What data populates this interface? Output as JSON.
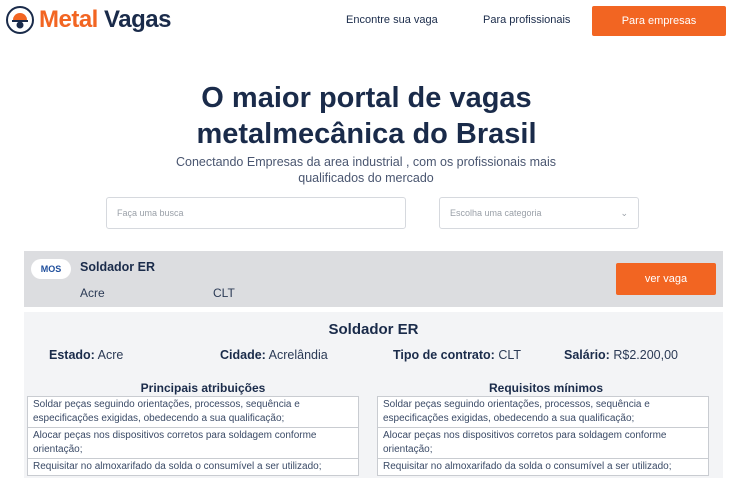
{
  "header": {
    "logo_part1": "Metal",
    "logo_part2": "Vagas",
    "nav": [
      "Encontre sua vaga",
      "Para profissionais"
    ],
    "cta": "Para empresas"
  },
  "hero": {
    "title_line1": "O maior portal de vagas",
    "title_line2": "metalmecânica do Brasil",
    "subtitle": "Conectando Empresas da area industrial , com os profissionais mais qualificados do mercado"
  },
  "search": {
    "placeholder": "Faça uma busca",
    "category_placeholder": "Escolha uma categoria"
  },
  "job": {
    "company_logo_text": "MOS",
    "title": "Soldador ER",
    "location": "Acre",
    "contract": "CLT",
    "button": "ver vaga"
  },
  "details": {
    "title": "Soldador ER",
    "estado_label": "Estado:",
    "estado_value": "Acre",
    "cidade_label": "Cidade:",
    "cidade_value": "Acrelândia",
    "contrato_label": "Tipo de contrato:",
    "contrato_value": "CLT",
    "salario_label": "Salário:",
    "salario_value": "R$2.200,00",
    "atribuicoes_title": "Principais atribuições",
    "requisitos_title": "Requisitos mínimos",
    "atribuicoes": [
      "Soldar peças seguindo orientações, processos, sequência e especificações exigidas, obedecendo a sua qualificação;",
      "Alocar peças nos dispositivos corretos para soldagem conforme orientação;",
      "Requisitar no almoxarifado da solda o consumível a ser utilizado;"
    ],
    "requisitos": [
      "Soldar peças seguindo orientações, processos, sequência e especificações exigidas, obedecendo a sua qualificação;",
      "Alocar peças nos dispositivos corretos para soldagem conforme orientação;",
      "Requisitar no almoxarifado da solda o consumível a ser utilizado;"
    ]
  },
  "colors": {
    "accent": "#f26522",
    "navy": "#1a2b4a"
  }
}
